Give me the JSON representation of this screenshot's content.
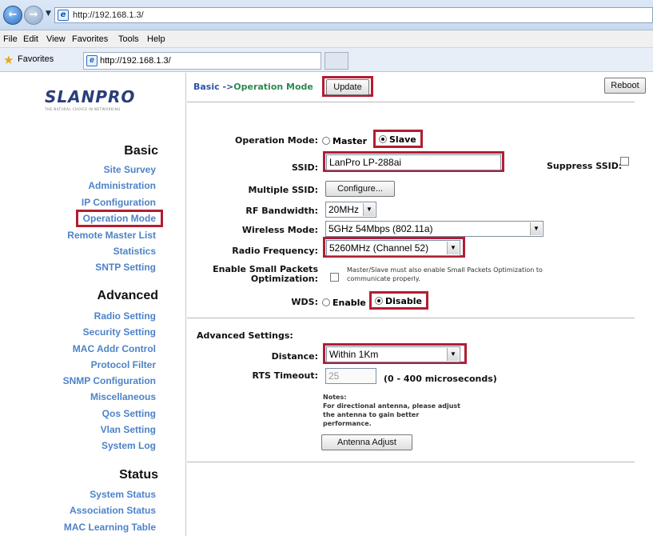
{
  "browser": {
    "url": "http://192.168.1.3/",
    "menu": [
      "File",
      "Edit",
      "View",
      "Favorites",
      "Tools",
      "Help"
    ],
    "favorites_label": "Favorites",
    "tab_url": "http://192.168.1.3/"
  },
  "logo": {
    "text": "SLANPRO",
    "tagline": "THE NATURAL CHOICE IN NETWORKING"
  },
  "sidebar": {
    "basic": {
      "heading": "Basic",
      "items": [
        "Site Survey",
        "Administration",
        "IP Configuration",
        "Operation Mode",
        "Remote Master List",
        "Statistics",
        "SNTP Setting"
      ]
    },
    "advanced": {
      "heading": "Advanced",
      "items": [
        "Radio Setting",
        "Security Setting",
        "MAC Addr Control",
        "Protocol Filter",
        "SNMP Configuration",
        "Miscellaneous",
        "Qos Setting",
        "Vlan Setting",
        "System Log"
      ]
    },
    "status": {
      "heading": "Status",
      "items": [
        "System Status",
        "Association Status",
        "MAC Learning Table"
      ]
    }
  },
  "header": {
    "title_prefix": "Basic ->",
    "title_mode": "Operation Mode",
    "update_label": "Update",
    "reboot_label": "Reboot"
  },
  "form": {
    "operation_mode": {
      "label": "Operation Mode:",
      "options": [
        "Master",
        "Slave"
      ],
      "selected": "Slave"
    },
    "ssid": {
      "label": "SSID:",
      "value": "LanPro LP-288ai"
    },
    "suppress_ssid": {
      "label": "Suppress SSID:",
      "checked": false
    },
    "multiple_ssid": {
      "label": "Multiple SSID:",
      "button": "Configure..."
    },
    "rf_bandwidth": {
      "label": "RF Bandwidth:",
      "value": "20MHz"
    },
    "wireless_mode": {
      "label": "Wireless Mode:",
      "value": "5GHz 54Mbps (802.11a)"
    },
    "radio_frequency": {
      "label": "Radio Frequency:",
      "value": "5260MHz (Channel 52)"
    },
    "small_packets": {
      "label_line1": "Enable Small Packets",
      "label_line2": "Optimization:",
      "note_line1": "Master/Slave must also enable Small Packets Optimization to",
      "note_line2": "communicate properly.",
      "checked": false
    },
    "wds": {
      "label": "WDS:",
      "options": [
        "Enable",
        "Disable"
      ],
      "selected": "Disable"
    }
  },
  "advanced": {
    "heading": "Advanced Settings:",
    "distance": {
      "label": "Distance:",
      "value": "Within 1Km"
    },
    "rts_timeout": {
      "label": "RTS Timeout:",
      "value": "25",
      "range": "(0 - 400 microseconds)"
    },
    "notes": [
      "Notes:",
      "For directional antenna, please adjust",
      "the antenna to gain better",
      "performance."
    ],
    "antenna_button": "Antenna Adjust"
  },
  "colors": {
    "highlight": "#b31d33",
    "link": "#4d83c8",
    "title": "#2c55a6",
    "mode": "#2c8a4f"
  }
}
